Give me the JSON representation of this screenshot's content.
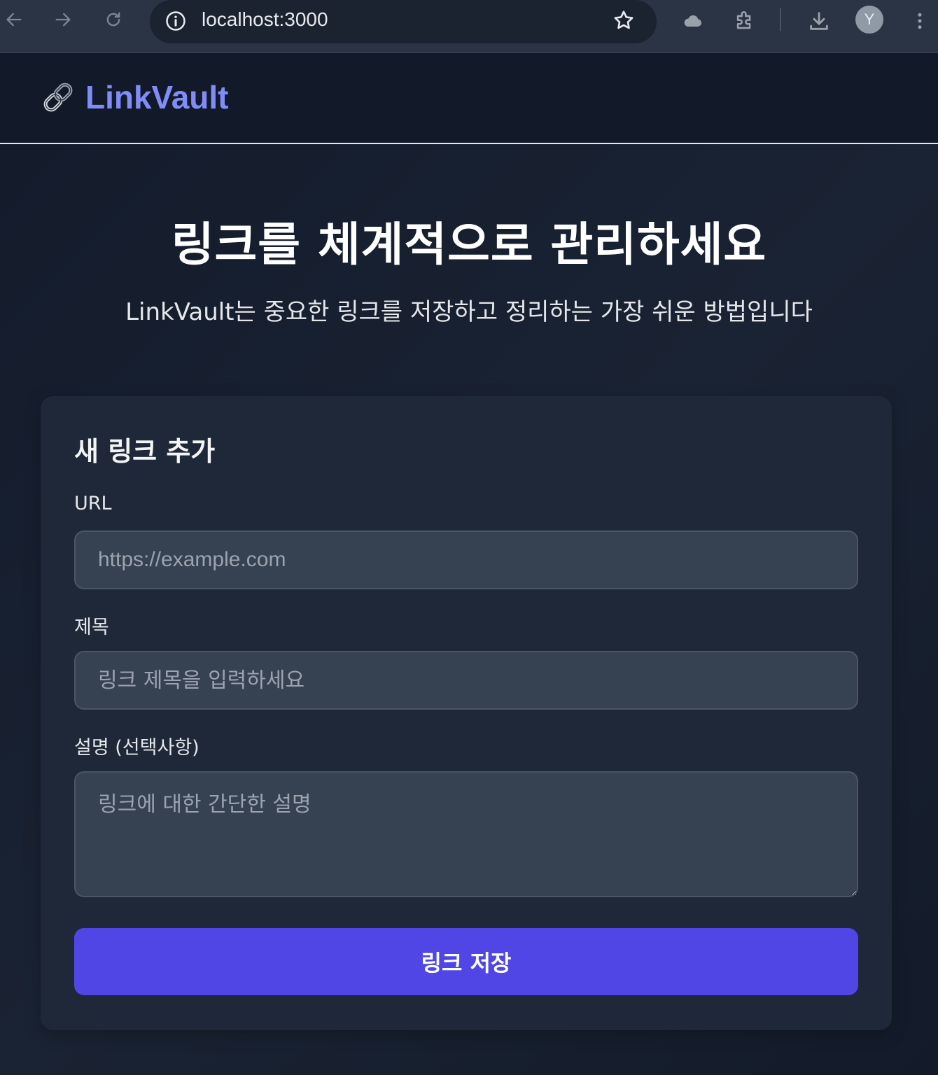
{
  "browser": {
    "url": "localhost:3000",
    "profile_initial": "Y",
    "icons": [
      "back-icon",
      "forward-icon",
      "reload-icon",
      "info-icon",
      "star-icon",
      "cloud-icon",
      "extensions-icon",
      "download-icon",
      "more-icon"
    ]
  },
  "header": {
    "logo_icon": "link-icon",
    "brand": "LinkVault",
    "brand_color": "#818cf8"
  },
  "hero": {
    "title": "링크를 체계적으로 관리하세요",
    "subtitle": "LinkVault는 중요한 링크를 저장하고 정리하는 가장 쉬운 방법입니다"
  },
  "form": {
    "title": "새 링크 추가",
    "url_label": "URL",
    "url_placeholder": "https://example.com",
    "title_label": "제목",
    "title_placeholder": "링크 제목을 입력하세요",
    "desc_label": "설명 (선택사항)",
    "desc_placeholder": "링크에 대한 간단한 설명",
    "submit_label": "링크 저장",
    "accent_color": "#4f46e5"
  }
}
